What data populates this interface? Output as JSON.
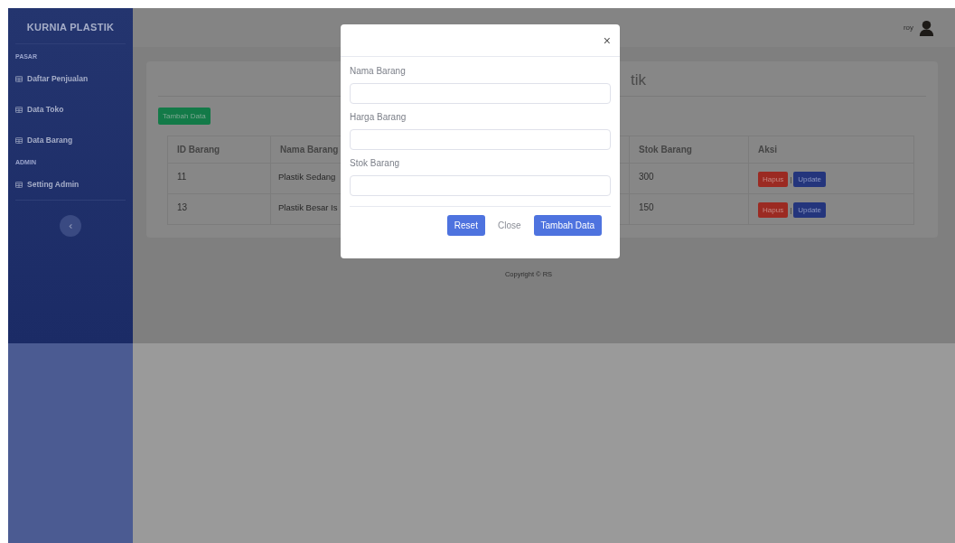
{
  "sidebar": {
    "brand": "KURNIA PLASTIK",
    "sections": [
      {
        "heading": "PASAR",
        "items": [
          {
            "label": "Daftar Penjualan"
          },
          {
            "label": "Data Toko"
          },
          {
            "label": "Data Barang"
          }
        ]
      },
      {
        "heading": "ADMIN",
        "items": [
          {
            "label": "Setting Admin"
          }
        ]
      }
    ]
  },
  "topbar": {
    "user_name": "roy"
  },
  "card": {
    "title": "tik",
    "add_button": "Tambah Data",
    "table": {
      "columns": [
        {
          "label": "ID Barang"
        },
        {
          "label": "Nama Barang"
        },
        {
          "label": "Stok Barang"
        },
        {
          "label": "Aksi"
        }
      ],
      "rows": [
        {
          "id_barang": "11",
          "nama_barang": "Plastik Sedang",
          "stok_barang": "300",
          "actions": {
            "delete": "Hapus",
            "separator": "|",
            "update": "Update"
          }
        },
        {
          "id_barang": "13",
          "nama_barang": "Plastik Besar Is",
          "stok_barang": "150",
          "actions": {
            "delete": "Hapus",
            "separator": "|",
            "update": "Update"
          }
        }
      ]
    }
  },
  "footer": {
    "copyright": "Copyright © RS"
  },
  "modal": {
    "close": "×",
    "fields": [
      {
        "label": "Nama Barang"
      },
      {
        "label": "Harga Barang"
      },
      {
        "label": "Stok Barang"
      }
    ],
    "buttons": [
      {
        "label": "Reset",
        "kind": "primary"
      },
      {
        "label": "Close",
        "kind": "link"
      },
      {
        "label": "Tambah Data",
        "kind": "primary"
      }
    ]
  }
}
